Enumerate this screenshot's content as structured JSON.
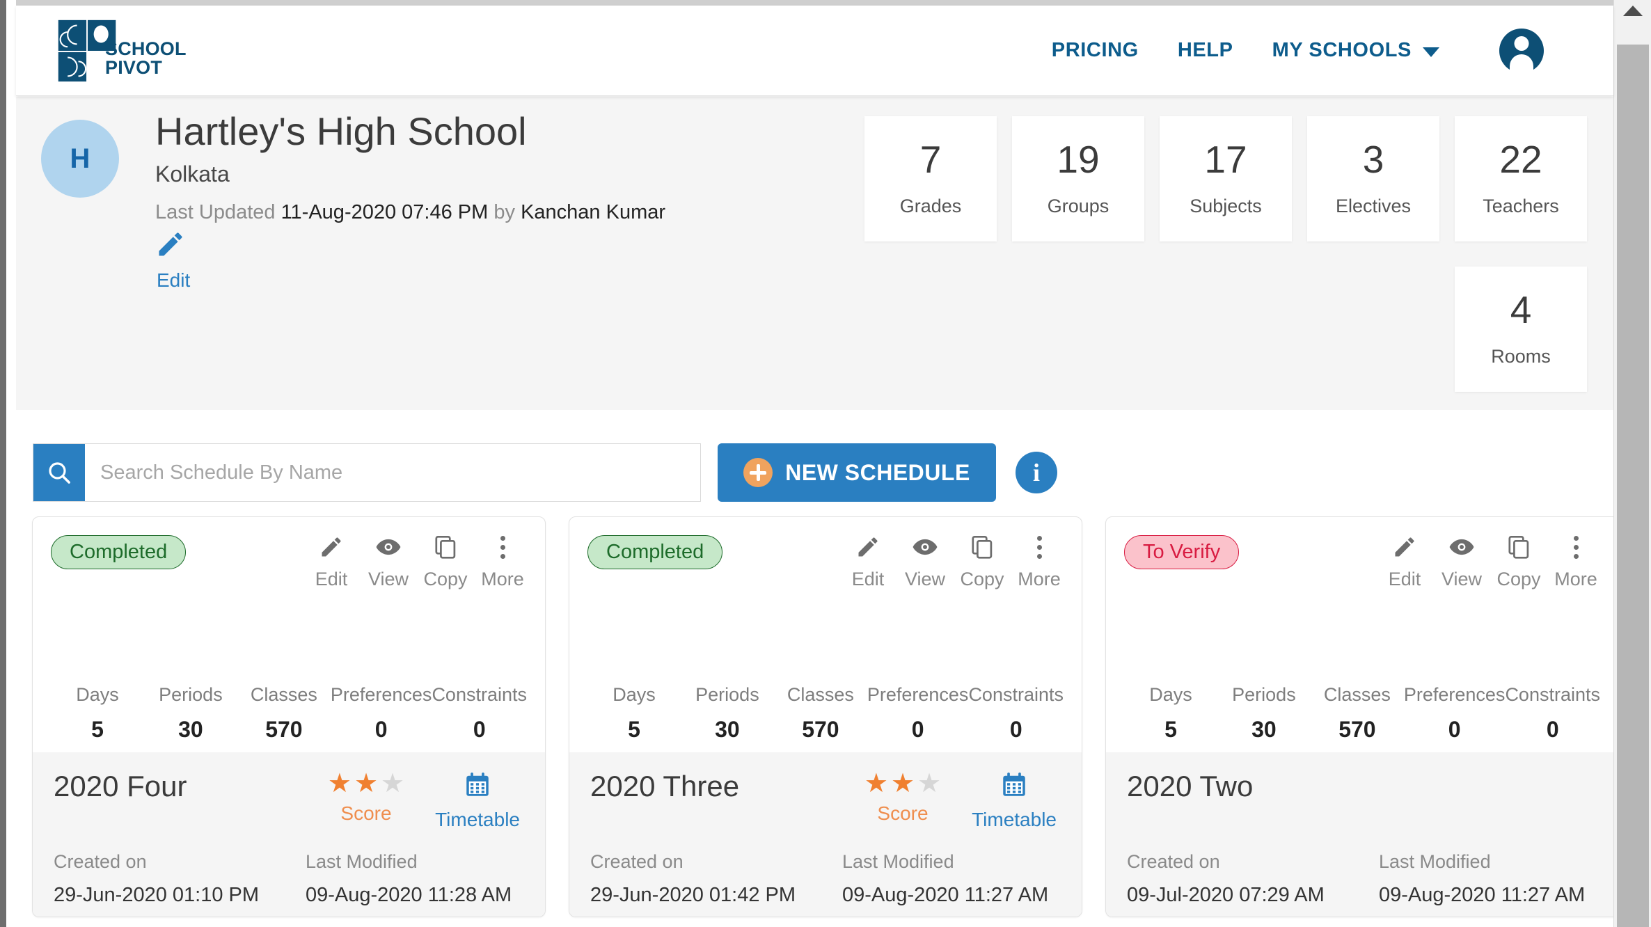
{
  "navbar": {
    "logo_text_line1": "SCHOOL",
    "logo_text_line2": "PIVOT",
    "logo_icon": "school-pivot-logo",
    "links": [
      {
        "label": "PRICING"
      },
      {
        "label": "HELP"
      },
      {
        "label": "MY SCHOOLS"
      }
    ],
    "chevron_icon": "chevron-down-icon",
    "avatar_icon": "user-account-icon"
  },
  "school": {
    "avatar_initial": "H",
    "name": "Hartley's High School",
    "city": "Kolkata",
    "updated_prefix": "Last Updated",
    "updated_datetime": "11-Aug-2020 07:46 PM",
    "updated_by_prefix": "by",
    "updated_by": "Kanchan Kumar",
    "edit_label": "Edit",
    "edit_icon": "pencil-icon",
    "stats": [
      {
        "value": "7",
        "label": "Grades"
      },
      {
        "value": "19",
        "label": "Groups"
      },
      {
        "value": "17",
        "label": "Subjects"
      },
      {
        "value": "3",
        "label": "Electives"
      },
      {
        "value": "22",
        "label": "Teachers"
      }
    ],
    "stats_row2": [
      {
        "value": "4",
        "label": "Rooms"
      }
    ]
  },
  "toolbar": {
    "search_placeholder": "Search Schedule By Name",
    "search_value": "",
    "search_icon": "search-icon",
    "new_schedule_label": "NEW SCHEDULE",
    "plus_icon": "plus-circle-icon",
    "info_label": "i",
    "info_icon": "info-icon"
  },
  "card_common": {
    "actions": [
      {
        "label": "Edit",
        "icon": "pencil-icon"
      },
      {
        "label": "View",
        "icon": "eye-icon"
      },
      {
        "label": "Copy",
        "icon": "copy-icon"
      },
      {
        "label": "More",
        "icon": "kebab-menu-icon"
      }
    ],
    "metric_labels": [
      "Days",
      "Periods",
      "Classes",
      "Preferences",
      "Constraints"
    ],
    "created_label": "Created on",
    "modified_label": "Last Modified",
    "score_label": "Score",
    "timetable_label": "Timetable",
    "timetable_icon": "calendar-icon"
  },
  "schedules": [
    {
      "status": "Completed",
      "status_type": "completed",
      "metrics": [
        "5",
        "30",
        "570",
        "0",
        "0"
      ],
      "title": "2020 Four",
      "has_score": true,
      "stars_filled": 2,
      "stars_total": 3,
      "created_on": "29-Jun-2020 01:10 PM",
      "last_modified": "09-Aug-2020 11:28 AM"
    },
    {
      "status": "Completed",
      "status_type": "completed",
      "metrics": [
        "5",
        "30",
        "570",
        "0",
        "0"
      ],
      "title": "2020 Three",
      "has_score": true,
      "stars_filled": 2,
      "stars_total": 3,
      "created_on": "29-Jun-2020 01:42 PM",
      "last_modified": "09-Aug-2020 11:27 AM"
    },
    {
      "status": "To Verify",
      "status_type": "verify",
      "metrics": [
        "5",
        "30",
        "570",
        "0",
        "0"
      ],
      "title": "2020 Two",
      "has_score": false,
      "stars_filled": 0,
      "stars_total": 3,
      "created_on": "09-Jul-2020 07:29 AM",
      "last_modified": "09-Aug-2020 11:27 AM"
    }
  ],
  "colors": {
    "brand_dark": "#0d4f75",
    "link_blue": "#2a7fc1",
    "accent_orange": "#f0a35e",
    "status_completed_bg": "#c6e8c9",
    "status_completed_fg": "#1d6b2a",
    "status_verify_bg": "#fbc2cb",
    "status_verify_fg": "#d81b41"
  },
  "scrollbar": {
    "up_arrow_icon": "scroll-up-arrow-icon"
  }
}
